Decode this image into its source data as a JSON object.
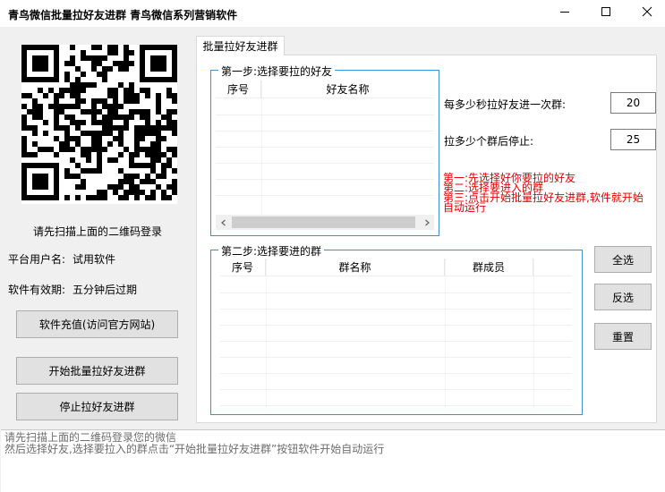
{
  "window": {
    "title": "青鸟微信批量拉好友进群 青鸟微信系列营销软件"
  },
  "left": {
    "qr_caption": "请先扫描上面的二维码登录",
    "user_label": "平台用户名:",
    "user_value": "试用软件",
    "validity_label": "软件有效期:",
    "validity_value": "五分钟后过期",
    "recharge_button": "软件充值(访问官方网站)",
    "start_button": "开始批量拉好友进群",
    "stop_button": "停止拉好友进群"
  },
  "tab": {
    "label": "批量拉好友进群"
  },
  "step1": {
    "legend": "第一步:选择要拉的好友",
    "columns": [
      "序号",
      "好友名称"
    ]
  },
  "step2": {
    "legend": "第二步:选择要进的群",
    "columns": [
      "序号",
      "群名称",
      "群成员"
    ]
  },
  "settings": {
    "interval_label": "每多少秒拉好友进一次群:",
    "interval_value": "20",
    "stop_after_label": "拉多少个群后停止:",
    "stop_after_value": "25"
  },
  "hint": [
    "第一:先选择好你要拉的好友",
    "第二:选择要进入的群",
    "第三:点击开始批量拉好友进群,软件就开始",
    "自动运行"
  ],
  "side_buttons": {
    "select_all": "全选",
    "invert": "反选",
    "reset": "重置"
  },
  "log": [
    "请先扫描上面的二维码登录您的微信",
    "然后选择好友,选择要拉入的群点击“开始批量拉好友进群”按钮软件开始自动运行"
  ],
  "colors": {
    "group_border": "#3b8fd6",
    "hint_text": "#e00000"
  },
  "icons": [
    "minimize-icon",
    "maximize-icon",
    "close-icon",
    "chevron-left-icon",
    "chevron-right-icon"
  ]
}
